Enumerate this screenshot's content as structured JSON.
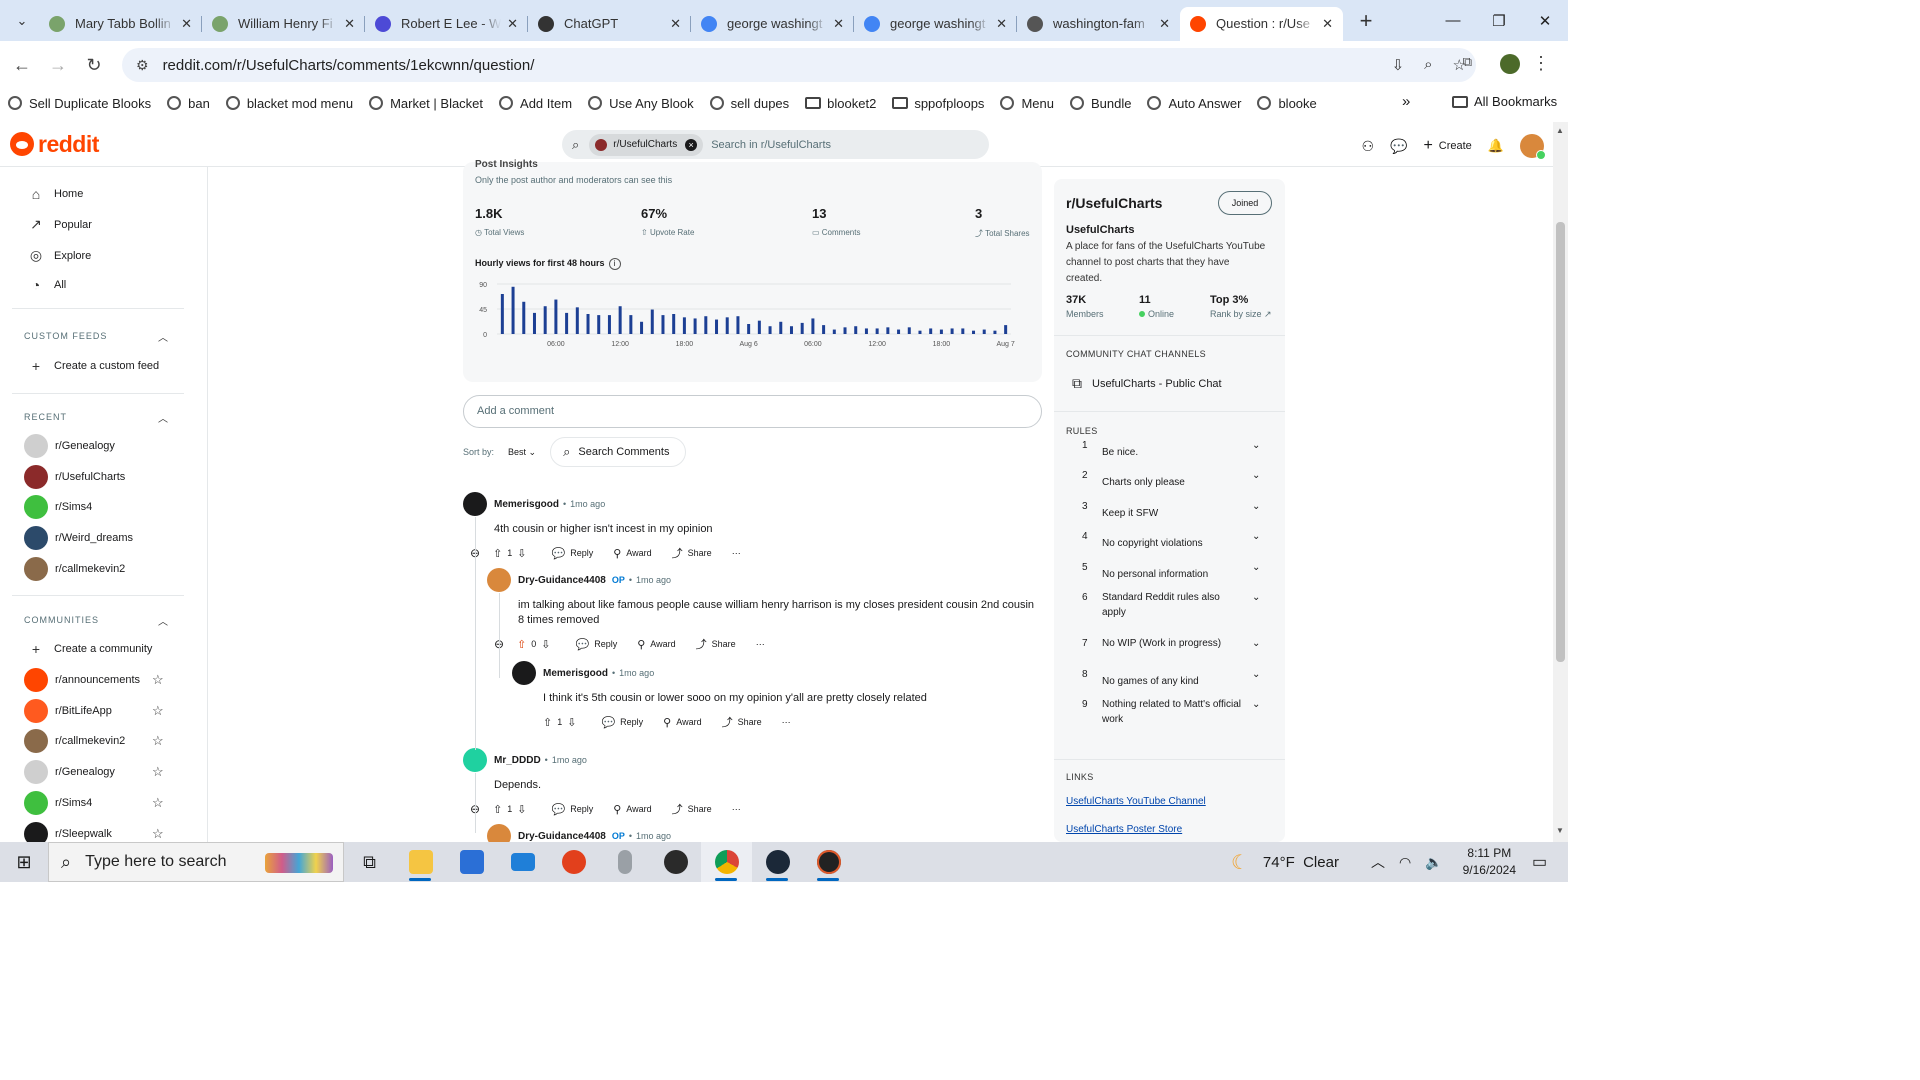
{
  "browser": {
    "tabs": [
      {
        "title": "Mary Tabb Bollin",
        "fav": "#7aa36b",
        "active": false
      },
      {
        "title": "William Henry Fi",
        "fav": "#7aa36b",
        "active": false
      },
      {
        "title": "Robert E Lee - W",
        "fav": "#4d4ad6",
        "active": false
      },
      {
        "title": "ChatGPT",
        "fav": "#333333",
        "active": false
      },
      {
        "title": "george washingt",
        "fav": "#4285f4",
        "active": false
      },
      {
        "title": "george washingt",
        "fav": "#4285f4",
        "active": false
      },
      {
        "title": "washington-fam",
        "fav": "#555555",
        "active": false
      },
      {
        "title": "Question : r/Use",
        "fav": "#ff4500",
        "active": true
      }
    ],
    "url": "reddit.com/r/UsefulCharts/comments/1ekcwnn/question/",
    "bookmarks": [
      {
        "label": "Sell Duplicate Blooks",
        "kind": "globe"
      },
      {
        "label": "ban",
        "kind": "globe"
      },
      {
        "label": "blacket mod menu",
        "kind": "globe"
      },
      {
        "label": "Market | Blacket",
        "kind": "globe"
      },
      {
        "label": "Add Item",
        "kind": "globe"
      },
      {
        "label": "Use Any Blook",
        "kind": "globe"
      },
      {
        "label": "sell dupes",
        "kind": "globe"
      },
      {
        "label": "blooket2",
        "kind": "folder"
      },
      {
        "label": "sppofploops",
        "kind": "folder"
      },
      {
        "label": "Menu",
        "kind": "globe"
      },
      {
        "label": "Bundle",
        "kind": "globe"
      },
      {
        "label": "Auto Answer",
        "kind": "globe"
      },
      {
        "label": "blooke",
        "kind": "globe"
      }
    ],
    "all_bookmarks": "All Bookmarks"
  },
  "reddit": {
    "logo": "reddit",
    "search_chip": "r/UsefulCharts",
    "search_placeholder": "Search in r/UsefulCharts",
    "create": "Create"
  },
  "nav": {
    "items": [
      {
        "label": "Home",
        "icon": "home-icon"
      },
      {
        "label": "Popular",
        "icon": "popular-icon"
      },
      {
        "label": "Explore",
        "icon": "explore-icon"
      },
      {
        "label": "All",
        "icon": "all-icon"
      }
    ],
    "custom_feeds_title": "CUSTOM FEEDS",
    "create_feed": "Create a custom feed",
    "recent_title": "RECENT",
    "recent": [
      {
        "label": "r/Genealogy",
        "color": "#cfcfcf"
      },
      {
        "label": "r/UsefulCharts",
        "color": "#8b2a2a"
      },
      {
        "label": "r/Sims4",
        "color": "#3fbf3f"
      },
      {
        "label": "r/Weird_dreams",
        "color": "#2c4a6a"
      },
      {
        "label": "r/callmekevin2",
        "color": "#8a6a4a"
      }
    ],
    "communities_title": "COMMUNITIES",
    "create_community": "Create a community",
    "communities": [
      {
        "label": "r/announcements",
        "color": "#ff4500"
      },
      {
        "label": "r/BitLifeApp",
        "color": "#ff5a1f"
      },
      {
        "label": "r/callmekevin2",
        "color": "#8a6a4a"
      },
      {
        "label": "r/Genealogy",
        "color": "#cfcfcf"
      },
      {
        "label": "r/Sims4",
        "color": "#3fbf3f"
      },
      {
        "label": "r/Sleepwalk",
        "color": "#1a1a1b"
      }
    ]
  },
  "insights": {
    "title": "Post Insights",
    "subtitle": "Only the post author and moderators can see this",
    "stats": [
      {
        "value": "1.8K",
        "label": "Total Views"
      },
      {
        "value": "67%",
        "label": "Upvote Rate"
      },
      {
        "value": "13",
        "label": "Comments"
      },
      {
        "value": "3",
        "label": "Total Shares"
      }
    ],
    "hourly_title": "Hourly views for first 48 hours"
  },
  "chart_data": {
    "type": "bar",
    "title": "Hourly views for first 48 hours",
    "ylim": [
      0,
      90
    ],
    "y_ticks": [
      "90",
      "45",
      "0"
    ],
    "x_ticks": [
      "06:00",
      "12:00",
      "18:00",
      "Aug 6",
      "06:00",
      "12:00",
      "18:00",
      "Aug 7"
    ],
    "values": [
      72,
      85,
      58,
      38,
      50,
      62,
      38,
      48,
      36,
      34,
      34,
      50,
      34,
      22,
      44,
      34,
      36,
      30,
      28,
      32,
      26,
      30,
      32,
      18,
      24,
      14,
      22,
      14,
      20,
      28,
      16,
      8,
      12,
      14,
      10,
      10,
      12,
      8,
      12,
      6,
      10,
      8,
      10,
      10,
      6,
      8,
      6,
      16
    ],
    "color": "#1c3f94"
  },
  "comments_ui": {
    "add_comment": "Add a comment",
    "sort_by": "Sort by:",
    "sort_value": "Best",
    "search_comments": "Search Comments",
    "reply": "Reply",
    "award": "Award",
    "share": "Share"
  },
  "comments": [
    {
      "author": "Memerisgood",
      "op": "",
      "time": "1mo ago",
      "text": "4th cousin or higher isn't incest in my opinion",
      "score": "1",
      "av": "#1a1a1b"
    },
    {
      "author": "Dry-Guidance4408",
      "op": "OP",
      "time": "1mo ago",
      "text": "im talking about like famous people cause william henry harrison is my closes president cousin 2nd cousin 8 times removed",
      "score": "0",
      "av": "#d9883c"
    },
    {
      "author": "Memerisgood",
      "op": "",
      "time": "1mo ago",
      "text": "I think it's 5th cousin or lower sooo on my opinion y'all are pretty closely related",
      "score": "1",
      "av": "#1a1a1b"
    },
    {
      "author": "Mr_DDDD",
      "op": "",
      "time": "1mo ago",
      "text": "Depends.",
      "score": "1",
      "av": "#1fd1a0"
    },
    {
      "author": "Dry-Guidance4408",
      "op": "OP",
      "time": "1mo ago",
      "text": "",
      "score": "",
      "av": "#d9883c"
    }
  ],
  "sidebar": {
    "title": "r/UsefulCharts",
    "joined": "Joined",
    "name": "UsefulCharts",
    "description": "A place for fans of the UsefulCharts YouTube channel to post charts that they have created.",
    "stats": [
      {
        "value": "37K",
        "label": "Members"
      },
      {
        "value": "11",
        "label": "Online"
      },
      {
        "value": "Top 3%",
        "label": "Rank by size"
      }
    ],
    "chat_title": "COMMUNITY CHAT CHANNELS",
    "chat_channel": "UsefulCharts - Public Chat",
    "rules_title": "RULES",
    "rules": [
      "Be nice.",
      "Charts only please",
      "Keep it SFW",
      "No copyright violations",
      "No personal information",
      "Standard Reddit rules also apply",
      "No WIP (Work in progress)",
      "No games of any kind",
      "Nothing related to Matt's official work"
    ],
    "links_title": "LINKS",
    "links": [
      "UsefulCharts YouTube Channel",
      "UsefulCharts Poster Store"
    ]
  },
  "taskbar": {
    "search": "Type here to search",
    "temp": "74°F",
    "weather": "Clear",
    "time": "8:11 PM",
    "date": "9/16/2024"
  }
}
